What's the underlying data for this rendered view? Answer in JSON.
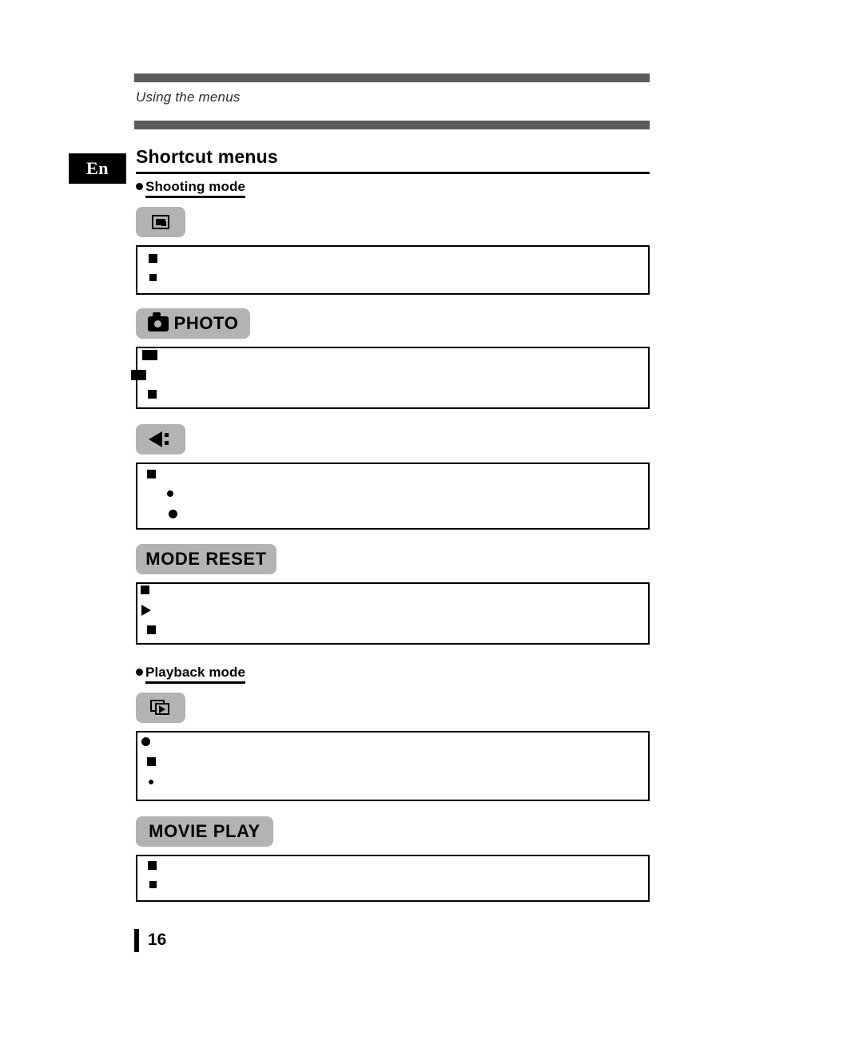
{
  "header": {
    "running_head": "Using the menus"
  },
  "language_tab": {
    "label": "En"
  },
  "title": {
    "text": "Shortcut menus"
  },
  "sections": [
    {
      "id": "shooting-mode",
      "heading": "Shooting mode"
    },
    {
      "id": "playback-mode",
      "heading": "Playback mode"
    }
  ],
  "chips": [
    {
      "id": "shooting-menu-icon",
      "label": "",
      "icon": "camera-menu-icon"
    },
    {
      "id": "photo",
      "label": "PHOTO",
      "icon": "camera-icon"
    },
    {
      "id": "flash-menu-icon",
      "label": "",
      "icon": "flash-arrow-icon"
    },
    {
      "id": "mode-reset",
      "label": "MODE RESET",
      "icon": ""
    },
    {
      "id": "playback-menu-icon",
      "label": "",
      "icon": "playback-frames-icon"
    },
    {
      "id": "movie-play",
      "label": "MOVIE PLAY",
      "icon": ""
    }
  ],
  "footer": {
    "page_number": "16"
  }
}
